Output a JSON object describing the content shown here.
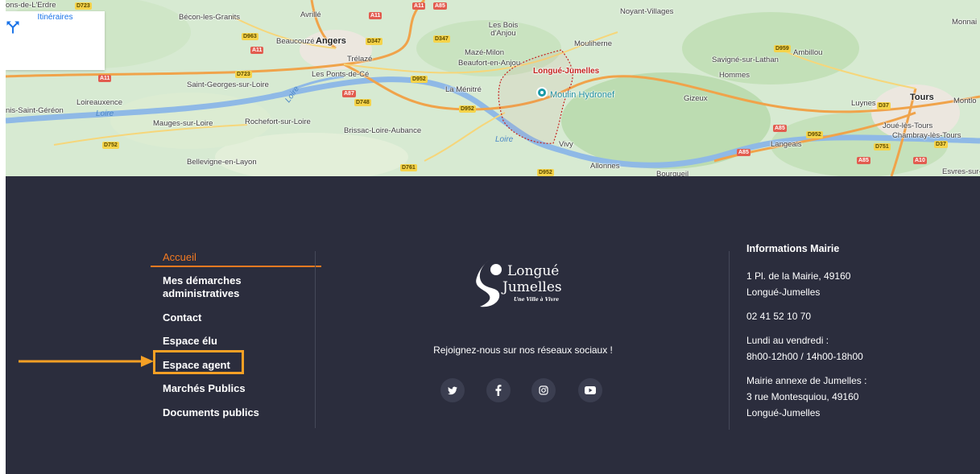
{
  "map": {
    "directions_label": "Itinéraires",
    "places": [
      {
        "name": "ons-de-L'Erdre",
        "cls": ""
      },
      {
        "name": "Bécon-les-Granits",
        "cls": ""
      },
      {
        "name": "Avrillé",
        "cls": ""
      },
      {
        "name": "Les Bois d'Anjou",
        "cls": ""
      },
      {
        "name": "Noyant-Villages",
        "cls": ""
      },
      {
        "name": "Monnai",
        "cls": ""
      },
      {
        "name": "Beaucouzé",
        "cls": ""
      },
      {
        "name": "Angers",
        "cls": "big"
      },
      {
        "name": "Mazé-Milon",
        "cls": ""
      },
      {
        "name": "Mouliherne",
        "cls": ""
      },
      {
        "name": "Trélazé",
        "cls": ""
      },
      {
        "name": "Beaufort-en-Anjou",
        "cls": ""
      },
      {
        "name": "Savigné-sur-Lathan",
        "cls": ""
      },
      {
        "name": "Ambillou",
        "cls": ""
      },
      {
        "name": "Les Ponts-de-Cé",
        "cls": ""
      },
      {
        "name": "Longué-Jumelles",
        "cls": "red"
      },
      {
        "name": "Hommes",
        "cls": ""
      },
      {
        "name": "Saint-Georges-sur-Loire",
        "cls": ""
      },
      {
        "name": "La Ménitré",
        "cls": ""
      },
      {
        "name": "Moulin Hydronef",
        "cls": "poi"
      },
      {
        "name": "Gizeux",
        "cls": ""
      },
      {
        "name": "Tours",
        "cls": "big"
      },
      {
        "name": "Montlo",
        "cls": ""
      },
      {
        "name": "Loireauxence",
        "cls": ""
      },
      {
        "name": "Luynes",
        "cls": ""
      },
      {
        "name": "nis-Saint-Géréon",
        "cls": ""
      },
      {
        "name": "Loire",
        "cls": "water"
      },
      {
        "name": "Mauges-sur-Loire",
        "cls": ""
      },
      {
        "name": "Rochefort-sur-Loire",
        "cls": ""
      },
      {
        "name": "Brissac-Loire-Aubance",
        "cls": ""
      },
      {
        "name": "Joué-lès-Tours",
        "cls": ""
      },
      {
        "name": "Chambray-lès-Tours",
        "cls": ""
      },
      {
        "name": "Loire",
        "cls": "water"
      },
      {
        "name": "Vivy",
        "cls": ""
      },
      {
        "name": "Langeais",
        "cls": ""
      },
      {
        "name": "Bellevigne-en-Layon",
        "cls": ""
      },
      {
        "name": "Allonnes",
        "cls": ""
      },
      {
        "name": "Bourgueil",
        "cls": ""
      },
      {
        "name": "Esvres-sur-",
        "cls": ""
      },
      {
        "name": "Loire",
        "cls": "water"
      }
    ],
    "roads": [
      {
        "label": "A11",
        "cls": "red"
      },
      {
        "label": "A11",
        "cls": "red"
      },
      {
        "label": "A85",
        "cls": "red"
      },
      {
        "label": "D963",
        "cls": "yellow"
      },
      {
        "label": "A11",
        "cls": "red"
      },
      {
        "label": "D347",
        "cls": "yellow"
      },
      {
        "label": "D347",
        "cls": "yellow"
      },
      {
        "label": "A11",
        "cls": "red"
      },
      {
        "label": "D723",
        "cls": "yellow"
      },
      {
        "label": "D952",
        "cls": "yellow"
      },
      {
        "label": "A87",
        "cls": "red"
      },
      {
        "label": "D748",
        "cls": "yellow"
      },
      {
        "label": "D952",
        "cls": "yellow"
      },
      {
        "label": "D752",
        "cls": "yellow"
      },
      {
        "label": "D761",
        "cls": "yellow"
      },
      {
        "label": "D952",
        "cls": "yellow"
      },
      {
        "label": "A85",
        "cls": "red"
      },
      {
        "label": "D952",
        "cls": "yellow"
      },
      {
        "label": "A85",
        "cls": "red"
      },
      {
        "label": "D751",
        "cls": "yellow"
      },
      {
        "label": "D37",
        "cls": "yellow"
      },
      {
        "label": "A85",
        "cls": "red"
      },
      {
        "label": "A10",
        "cls": "red"
      },
      {
        "label": "D959",
        "cls": "yellow"
      },
      {
        "label": "D37",
        "cls": "yellow"
      }
    ]
  },
  "footer": {
    "nav": [
      {
        "label": "Accueil"
      },
      {
        "label": "Mes démarches administratives"
      },
      {
        "label": "Contact"
      },
      {
        "label": "Espace élu"
      },
      {
        "label": "Espace agent"
      },
      {
        "label": "Marchés Publics"
      },
      {
        "label": "Documents publics"
      }
    ],
    "logo": {
      "line1": "Longué",
      "line2": "Jumelles",
      "tagline": "Une Ville à Vivre"
    },
    "social_text": "Rejoignez-nous sur nos réseaux sociaux !",
    "info": {
      "title": "Informations Mairie",
      "address_line1": "1 Pl. de la Mairie, 49160",
      "address_line2": "Longué-Jumelles",
      "phone": "02 41 52 10 70",
      "hours_line1": "Lundi au vendredi :",
      "hours_line2": "8h00-12h00 / 14h00-18h00",
      "annex_line1": "Mairie annexe de Jumelles :",
      "annex_line2": "3 rue Montesquiou, 49160",
      "annex_line3": "Longué-Jumelles"
    }
  },
  "colors": {
    "accent": "#f47a21",
    "highlight": "#f5a025",
    "footer_bg": "#2b2d3d",
    "map_directions": "#1a73e8"
  }
}
